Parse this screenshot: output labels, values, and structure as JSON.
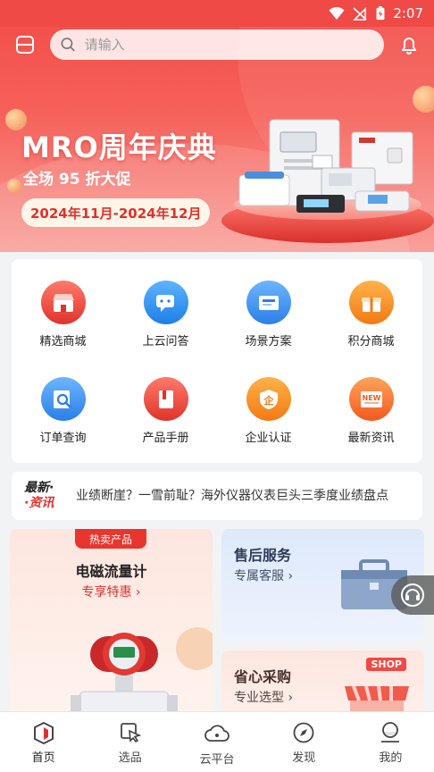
{
  "status_bar": {
    "time": "2:07"
  },
  "search": {
    "placeholder": "请输入"
  },
  "banner": {
    "title": "MRO周年庆典",
    "subtitle": "全场 95 折大促",
    "date_range": "2024年11月-2024年12月"
  },
  "grid": [
    {
      "label": "精选商城",
      "icon": "mall-icon",
      "color": "#f0453c"
    },
    {
      "label": "上云问答",
      "icon": "qa-icon",
      "color": "#2b8ff0"
    },
    {
      "label": "场景方案",
      "icon": "solution-icon",
      "color": "#3a8df2"
    },
    {
      "label": "积分商城",
      "icon": "gift-icon",
      "color": "#f58c22"
    },
    {
      "label": "订单查询",
      "icon": "order-search-icon",
      "color": "#2f8ff0"
    },
    {
      "label": "产品手册",
      "icon": "manual-icon",
      "color": "#f0453c"
    },
    {
      "label": "企业认证",
      "icon": "certify-icon",
      "color": "#f58c22"
    },
    {
      "label": "最新资讯",
      "icon": "news-icon",
      "color": "#f26a2c"
    }
  ],
  "news": {
    "tag_line1": "最新·",
    "tag_line2": "·资讯",
    "text": "业绩断崖？一雪前耻？海外仪器仪表巨头三季度业绩盘点"
  },
  "promo": {
    "hot_tag": "热卖产品",
    "left_title": "电磁流量计",
    "left_sub": "专享特惠 ›",
    "right_a_title": "售后服务",
    "right_a_sub": "专属客服 ›",
    "right_b_title": "省心采购",
    "right_b_sub": "专业选型 ›",
    "shop_label": "SHOP"
  },
  "tabbar": [
    {
      "label": "首页",
      "icon": "home-icon",
      "active": true
    },
    {
      "label": "选品",
      "icon": "select-product-icon"
    },
    {
      "label": "云平台",
      "icon": "cloud-icon"
    },
    {
      "label": "发现",
      "icon": "compass-icon"
    },
    {
      "label": "我的",
      "icon": "profile-icon"
    }
  ],
  "colors": {
    "brand_red": "#f04a46",
    "accent": "#e0312d"
  }
}
